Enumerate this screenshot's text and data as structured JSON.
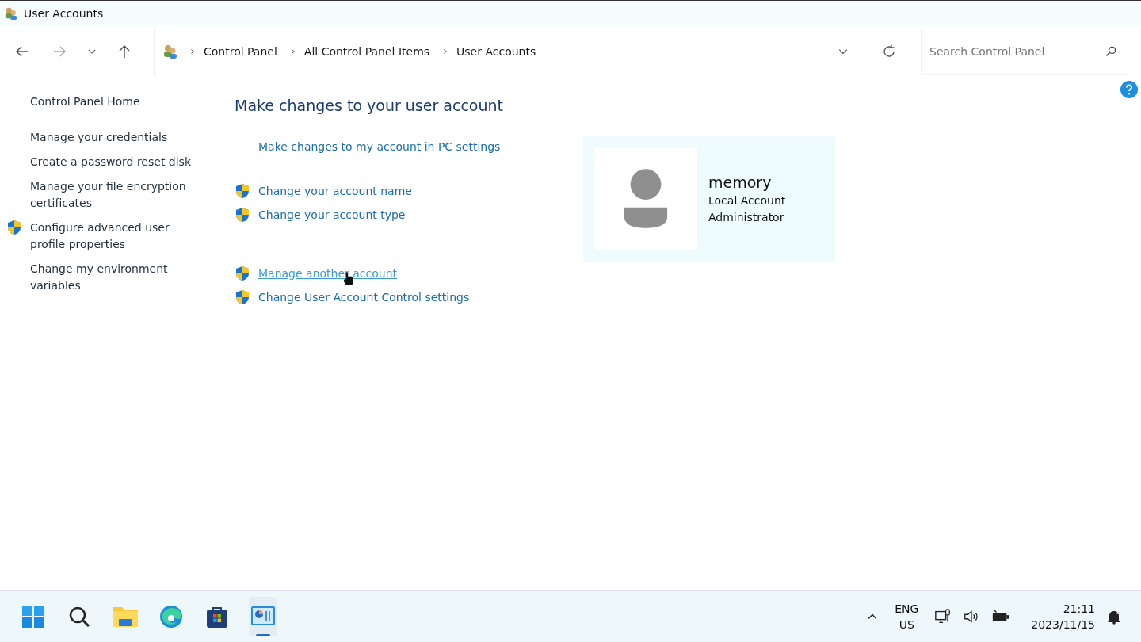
{
  "window": {
    "title": "User Accounts"
  },
  "breadcrumb": [
    "Control Panel",
    "All Control Panel Items",
    "User Accounts"
  ],
  "search": {
    "placeholder": "Search Control Panel"
  },
  "sidebar": {
    "items": [
      {
        "label": "Control Panel Home",
        "shield": false,
        "kind": "home"
      },
      {
        "label": "Manage your credentials",
        "shield": false,
        "kind": "task"
      },
      {
        "label": "Create a password reset disk",
        "shield": false,
        "kind": "task"
      },
      {
        "label": "Manage your file encryption certificates",
        "shield": false,
        "kind": "task"
      },
      {
        "label": "Configure advanced user profile properties",
        "shield": true,
        "kind": "task"
      },
      {
        "label": "Change my environment variables",
        "shield": false,
        "kind": "task"
      }
    ]
  },
  "main": {
    "heading": "Make changes to your user account",
    "groups": [
      [
        {
          "label": "Make changes to my account in PC settings",
          "shield": false,
          "hovered": false
        }
      ],
      [
        {
          "label": "Change your account name",
          "shield": true,
          "hovered": false
        },
        {
          "label": "Change your account type",
          "shield": true,
          "hovered": false
        }
      ],
      [
        {
          "label": "Manage another account",
          "shield": true,
          "hovered": true
        },
        {
          "label": "Change User Account Control settings",
          "shield": true,
          "hovered": false
        }
      ]
    ]
  },
  "account": {
    "name": "memory",
    "type": "Local Account",
    "role": "Administrator"
  },
  "taskbar": {
    "apps": [
      {
        "kind": "start",
        "selected": false
      },
      {
        "kind": "search",
        "selected": false
      },
      {
        "kind": "folder",
        "selected": false
      },
      {
        "kind": "browser",
        "selected": false
      },
      {
        "kind": "store",
        "selected": false
      },
      {
        "kind": "control-panel",
        "selected": true
      }
    ],
    "language": [
      "ENG",
      "US"
    ],
    "time": "21:11",
    "date": "2023/11/15"
  }
}
